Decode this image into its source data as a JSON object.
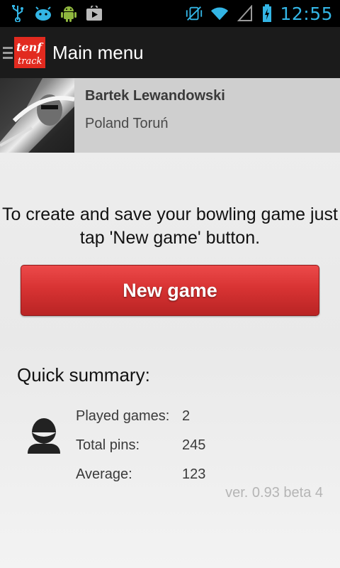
{
  "status_bar": {
    "time": "12:55",
    "icons": [
      "usb-icon",
      "android-debug-icon",
      "android-icon",
      "play-store-icon",
      "vibrate-icon",
      "wifi-icon",
      "signal-icon",
      "battery-icon"
    ]
  },
  "action_bar": {
    "title": "Main menu",
    "logo_text": "tenf track"
  },
  "profile": {
    "name": "Bartek Lewandowski",
    "location": "Poland Toruń"
  },
  "info_text": "To create and save your bowling game just tap 'New game' button.",
  "new_game_label": "New game",
  "summary": {
    "title": "Quick summary:",
    "rows": [
      {
        "label": "Played games:",
        "value": "2"
      },
      {
        "label": "Total pins:",
        "value": "245"
      },
      {
        "label": "Average:",
        "value": "123"
      }
    ]
  },
  "version": "ver. 0.93 beta 4",
  "colors": {
    "accent_red": "#d83333",
    "status_blue": "#33b5e5",
    "actionbar_bg": "#1b1b1b"
  }
}
